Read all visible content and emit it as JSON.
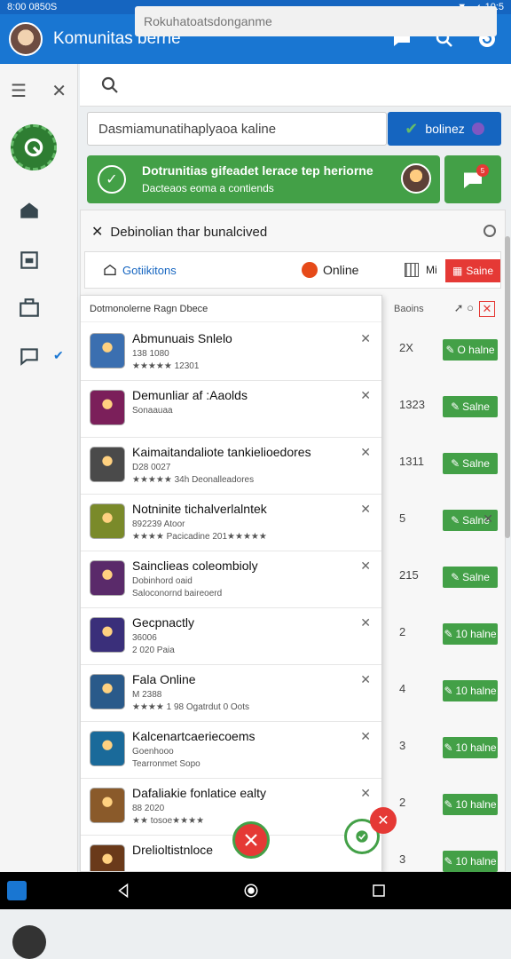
{
  "status_bar": {
    "time_left": "8:00 0850S",
    "time_right": "10:5"
  },
  "app_bar": {
    "title": "Komunitas berne"
  },
  "search": {
    "placeholder": "Rokuhatoatsdonganme"
  },
  "filter": {
    "value": "Dasmiamunatihaplyaoa kaline"
  },
  "online_button": {
    "label": "bolinez"
  },
  "banner": {
    "title": "Dotrunitias gifeadet lerace tep heriorne",
    "subtitle": "Dacteaos eoma a contiends",
    "chat_badge": "5"
  },
  "panel": {
    "title": "Debinolian thar bunalcived",
    "tabs": {
      "games": "Gotiikitons",
      "online": "Online",
      "grid": "Mi",
      "red": "Saine"
    }
  },
  "list": {
    "header": "Dotmonolerne Ragn Dbece",
    "right_header": "Baoins",
    "rows": [
      {
        "name": "Abmunuais Snlelo",
        "sub1": "138 1080",
        "sub2": "★★★★★ 12301",
        "thumb": "#3b6fb0",
        "count": "2X",
        "btn": "O halne"
      },
      {
        "name": "Demunliar af :Aaolds",
        "sub1": "Sonaauaa",
        "sub2": "",
        "thumb": "#7b1f5a",
        "count": "1323",
        "btn": "Salne"
      },
      {
        "name": "Kaimaitandaliote tankielioedores",
        "sub1": "D28 0027",
        "sub2": "★★★★★ 34h   Deonalleadores",
        "thumb": "#4a4a4a",
        "count": "1311",
        "btn": "Salne"
      },
      {
        "name": "Notninite tichalverlalntek",
        "sub1": "892239 Atoor",
        "sub2": "★★★★ Pacicadine  201★★★★★",
        "thumb": "#7a8a2a",
        "count": "5",
        "btn": "Salne"
      },
      {
        "name": "Sainclieas coleombioly",
        "sub1": "Dobinhord oaid",
        "sub2": "Saloconornd baireoerd",
        "thumb": "#5a2a6a",
        "count": "215",
        "btn": "Salne"
      },
      {
        "name": "Gecpnactly",
        "sub1": "36006",
        "sub2": "2 020   Paia",
        "thumb": "#3a2f7a",
        "count": "2",
        "btn": "10 halne"
      },
      {
        "name": "Fala Online",
        "sub1": "M 2388",
        "sub2": "★★★★ 1 98   Ogatrdut 0 Oots",
        "thumb": "#2a5a8a",
        "count": "4",
        "btn": "10 halne"
      },
      {
        "name": "Kalcenartcaeriecoems",
        "sub1": "Goenhooo",
        "sub2": "Tearronmet Sopo",
        "thumb": "#1a6a9a",
        "count": "3",
        "btn": "10 halne"
      },
      {
        "name": "Dafaliakie fonlatice ealty",
        "sub1": "88 2020",
        "sub2": "★★ tosoe★★★★",
        "thumb": "#8a5a2a",
        "count": "2",
        "btn": "10 halne"
      },
      {
        "name": "Drelioltistnloce",
        "sub1": "",
        "sub2": "",
        "thumb": "#6a3a1a",
        "count": "3",
        "btn": "10 halne"
      }
    ]
  },
  "colors": {
    "primary": "#1976d2",
    "green": "#43a047",
    "red": "#e53935"
  }
}
